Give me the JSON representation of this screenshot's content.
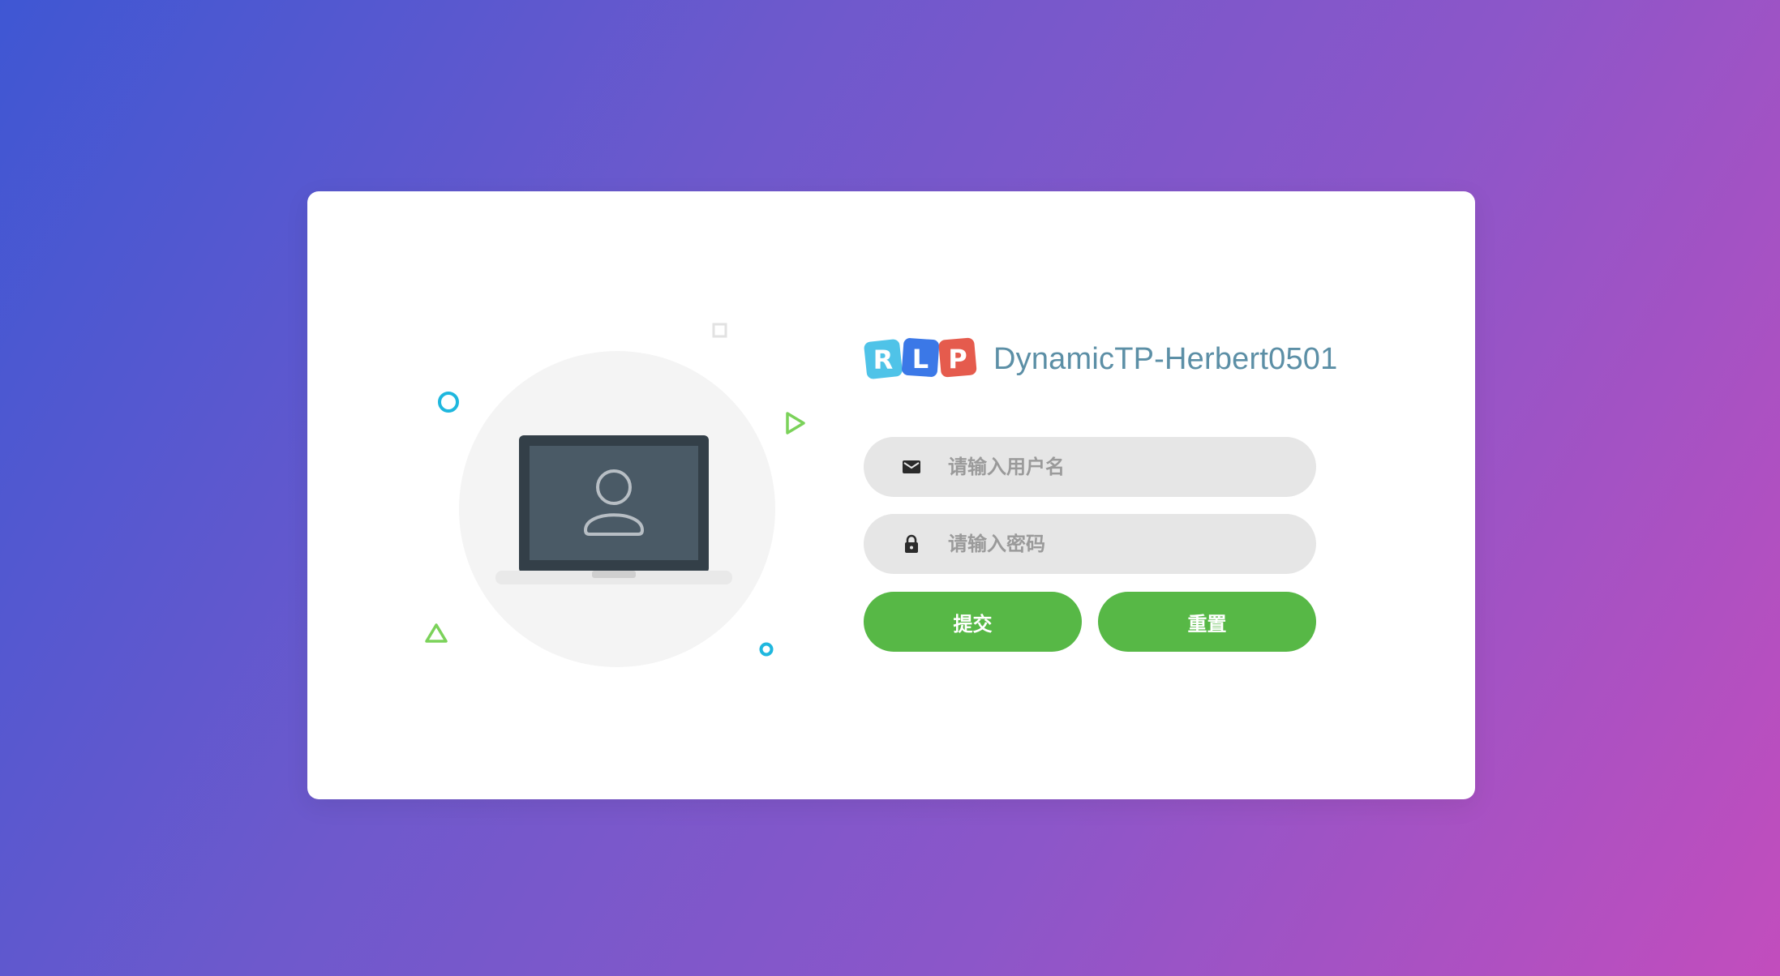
{
  "brand": {
    "logo_letters": [
      "R",
      "L",
      "P"
    ],
    "title": "DynamicTP-Herbert0501",
    "title_color": "#5c8fa6"
  },
  "form": {
    "username": {
      "value": "",
      "placeholder": "请输入用户名",
      "icon": "envelope-icon"
    },
    "password": {
      "value": "",
      "placeholder": "请输入密码",
      "icon": "lock-icon"
    },
    "submit_label": "提交",
    "reset_label": "重置"
  },
  "colors": {
    "button": "#57b846",
    "field_bg": "#e6e6e6",
    "accent_cyan": "#1fb7de",
    "accent_green": "#7bd25a"
  },
  "illustration": {
    "icons": [
      "laptop-icon",
      "user-icon"
    ]
  }
}
